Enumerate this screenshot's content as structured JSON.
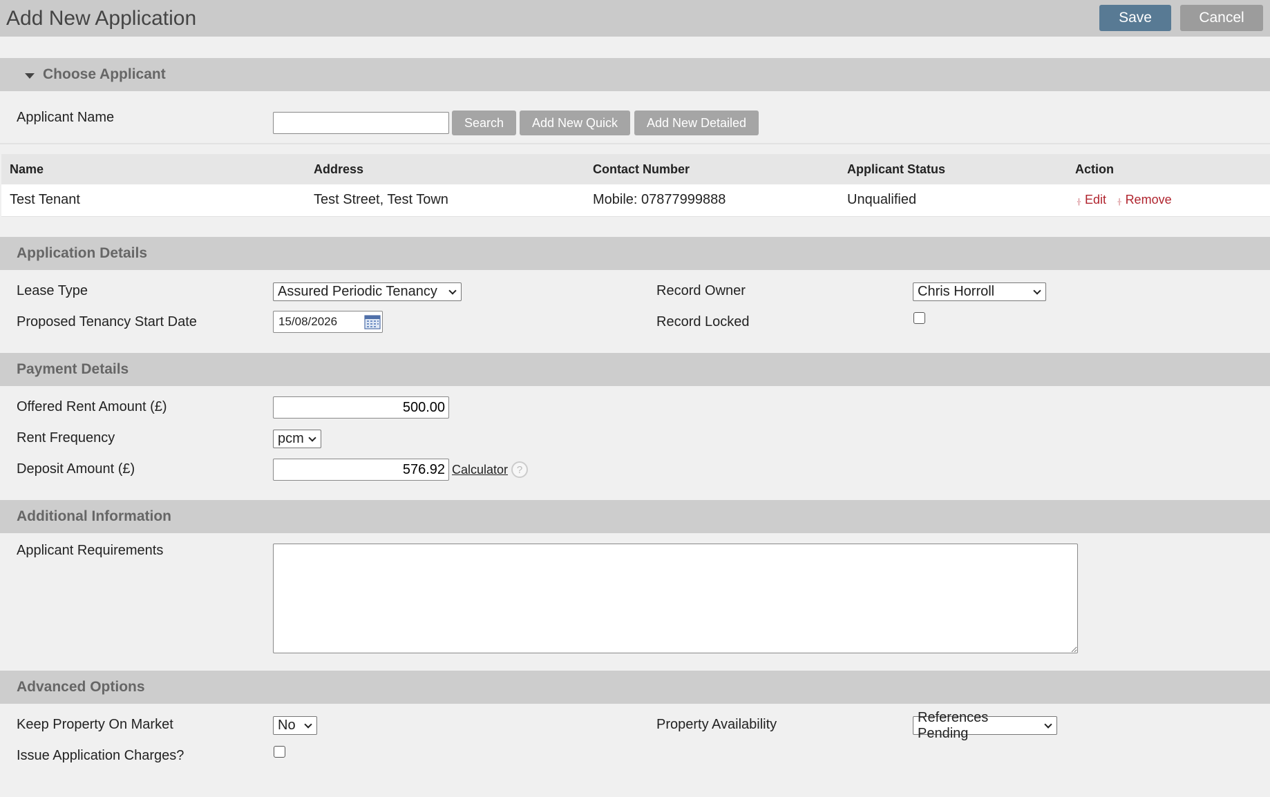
{
  "page": {
    "title": "Add New Application",
    "save_label": "Save",
    "cancel_label": "Cancel"
  },
  "choose_applicant": {
    "header": "Choose Applicant",
    "name_label": "Applicant Name",
    "name_value": "",
    "search_label": "Search",
    "add_quick_label": "Add New Quick",
    "add_detailed_label": "Add New Detailed",
    "table": {
      "columns": [
        "Name",
        "Address",
        "Contact Number",
        "Applicant Status",
        "Action"
      ],
      "rows": [
        {
          "name": "Test Tenant",
          "address": "Test Street, Test Town",
          "contact": "Mobile: 07877999888",
          "status": "Unqualified",
          "edit_label": "Edit",
          "remove_label": "Remove"
        }
      ]
    }
  },
  "application_details": {
    "header": "Application Details",
    "lease_type_label": "Lease Type",
    "lease_type_value": "Assured Periodic Tenancy",
    "start_date_label": "Proposed Tenancy Start Date",
    "start_date_value": "15/08/2026",
    "record_owner_label": "Record Owner",
    "record_owner_value": "Chris Horroll",
    "record_locked_label": "Record Locked",
    "record_locked_checked": false
  },
  "payment_details": {
    "header": "Payment Details",
    "rent_amount_label": "Offered Rent Amount (£)",
    "rent_amount_value": "500.00",
    "rent_frequency_label": "Rent Frequency",
    "rent_frequency_value": "pcm",
    "deposit_label": "Deposit Amount (£)",
    "deposit_value": "576.92",
    "calculator_label": "Calculator",
    "help_glyph": "?"
  },
  "additional_information": {
    "header": "Additional Information",
    "requirements_label": "Applicant Requirements",
    "requirements_value": ""
  },
  "advanced_options": {
    "header": "Advanced Options",
    "keep_on_market_label": "Keep Property On Market",
    "keep_on_market_value": "No",
    "availability_label": "Property Availability",
    "availability_value": "References Pending",
    "issue_charges_label": "Issue Application Charges?",
    "issue_charges_checked": false
  },
  "colors": {
    "primary_button": "#587a94",
    "secondary_button": "#9c9c9c",
    "action_link": "#b0242e",
    "section_header_bg": "#cdcdcd"
  }
}
